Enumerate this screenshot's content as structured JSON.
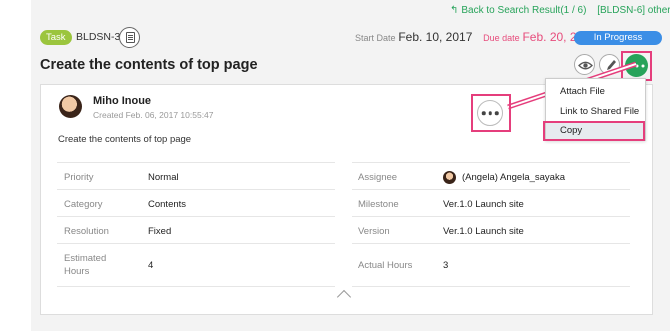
{
  "nav": {
    "back_link": "Back to Search Result(1 / 6)",
    "other_link": "[BLDSN-6] other",
    "back_icon": "↰"
  },
  "issue": {
    "type_badge": "Task",
    "key": "BLDSN-3",
    "start_label": "Start Date",
    "start_date": "Feb. 10, 2017",
    "due_label": "Due date",
    "due_date": "Feb. 20, 2017",
    "status": "In Progress",
    "title": "Create the contents of top page"
  },
  "comment": {
    "author": "Miho Inoue",
    "created": "Created  Feb. 06, 2017 10:55:47",
    "description": "Create the contents of top page"
  },
  "menu": {
    "items": [
      "Attach File",
      "Link to Shared File",
      "Copy"
    ]
  },
  "fields": {
    "left": [
      {
        "label": "Priority",
        "value": "Normal"
      },
      {
        "label": "Category",
        "value": "Contents"
      },
      {
        "label": "Resolution",
        "value": "Fixed"
      },
      {
        "label": "Estimated Hours",
        "value": "4"
      }
    ],
    "right": [
      {
        "label": "Assignee",
        "value": "(Angela) Angela_sayaka"
      },
      {
        "label": "Milestone",
        "value": "Ver.1.0 Launch site"
      },
      {
        "label": "Version",
        "value": "Ver.1.0 Launch site"
      },
      {
        "label": "Actual Hours",
        "value": "3"
      }
    ]
  },
  "icons": {
    "watch": "eye-icon",
    "edit": "pencil-icon",
    "more": "more-icon",
    "copy_key": "clipboard-icon",
    "collapse": "chevron-up-icon"
  },
  "colors": {
    "accent": "#27a35a",
    "status": "#3b8ee6",
    "due": "#e74c7c",
    "highlight": "#e53e7c",
    "badge": "#9bc53d"
  }
}
